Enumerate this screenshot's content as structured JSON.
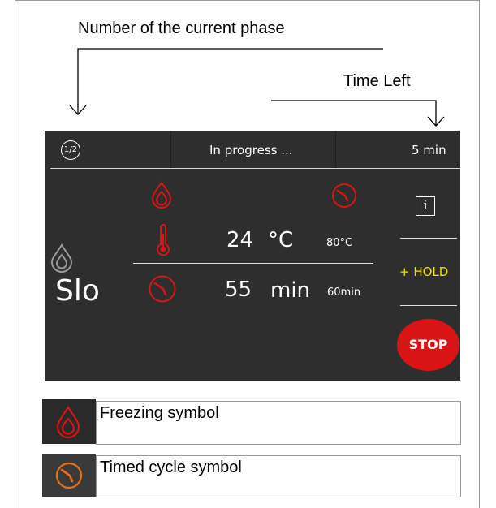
{
  "annotations": {
    "phase_number": "Number of the current phase",
    "time_left": "Time Left"
  },
  "screen": {
    "phase_badge": "1/2",
    "status": "In progress ...",
    "time_remaining": "5 min",
    "temperature_value": "24",
    "temperature_unit": "°C",
    "temperature_target": "80°C",
    "time_value": "55",
    "time_unit": "min",
    "time_target": "60min",
    "program_label": "Slo",
    "info_label": "i",
    "hold_label": "+ HOLD",
    "stop_label": "STOP"
  },
  "legend": [
    {
      "label": "Freezing symbol",
      "icon": "drop-icon"
    },
    {
      "label": "Timed cycle symbol",
      "icon": "clock-icon"
    }
  ],
  "colors": {
    "screen_bg": "#2e2e2e",
    "accent_red": "#d81414",
    "hold_yellow": "#f0e000",
    "timed_orange": "#e8701a"
  }
}
